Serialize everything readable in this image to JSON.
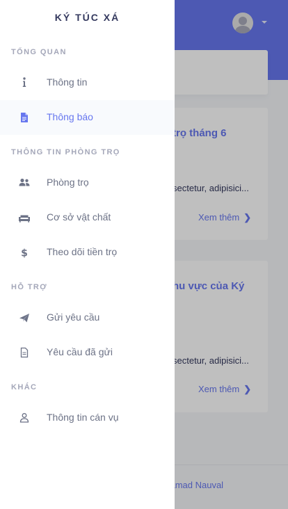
{
  "background_page": {
    "card1": {
      "title": "trọ tháng 6",
      "text": "sectetur, adipisici...",
      "link": "Xem thêm"
    },
    "card2": {
      "title_line1": "hu vực của Ký",
      "text": "sectetur, adipisici...",
      "link": "Xem thêm"
    },
    "footer_text": "uhamad Nauval",
    "chevron_icon": "chevron-right-icon",
    "user_icon": "user-avatar-icon"
  },
  "sidebar": {
    "brand": "KÝ TÚC XÁ",
    "sections": [
      {
        "header": "TỔNG QUAN",
        "items": [
          {
            "label": "Thông tin",
            "icon": "info-icon",
            "active": false
          },
          {
            "label": "Thông báo",
            "icon": "file-icon",
            "active": true
          }
        ]
      },
      {
        "header": "THÔNG TIN PHÒNG TRỌ",
        "items": [
          {
            "label": "Phòng trọ",
            "icon": "users-icon",
            "active": false
          },
          {
            "label": "Cơ sở vật chất",
            "icon": "couch-icon",
            "active": false
          },
          {
            "label": "Theo dõi tiền trọ",
            "icon": "dollar-icon",
            "active": false
          }
        ]
      },
      {
        "header": "HỖ TRỢ",
        "items": [
          {
            "label": "Gửi yêu cầu",
            "icon": "paper-plane-icon",
            "active": false
          },
          {
            "label": "Yêu cầu đã gửi",
            "icon": "file-outline-icon",
            "active": false
          }
        ]
      },
      {
        "header": "KHÁC",
        "items": [
          {
            "label": "Thông tin cán vụ",
            "icon": "user-outline-icon",
            "active": false
          }
        ]
      }
    ]
  },
  "colors": {
    "accent": "#6777ef",
    "sidebar_bg": "#ffffff",
    "active_item_bg": "#f8fafd",
    "menu_text": "#6c7286",
    "menu_header": "#a4a7b9",
    "icon": "#6c7286"
  }
}
